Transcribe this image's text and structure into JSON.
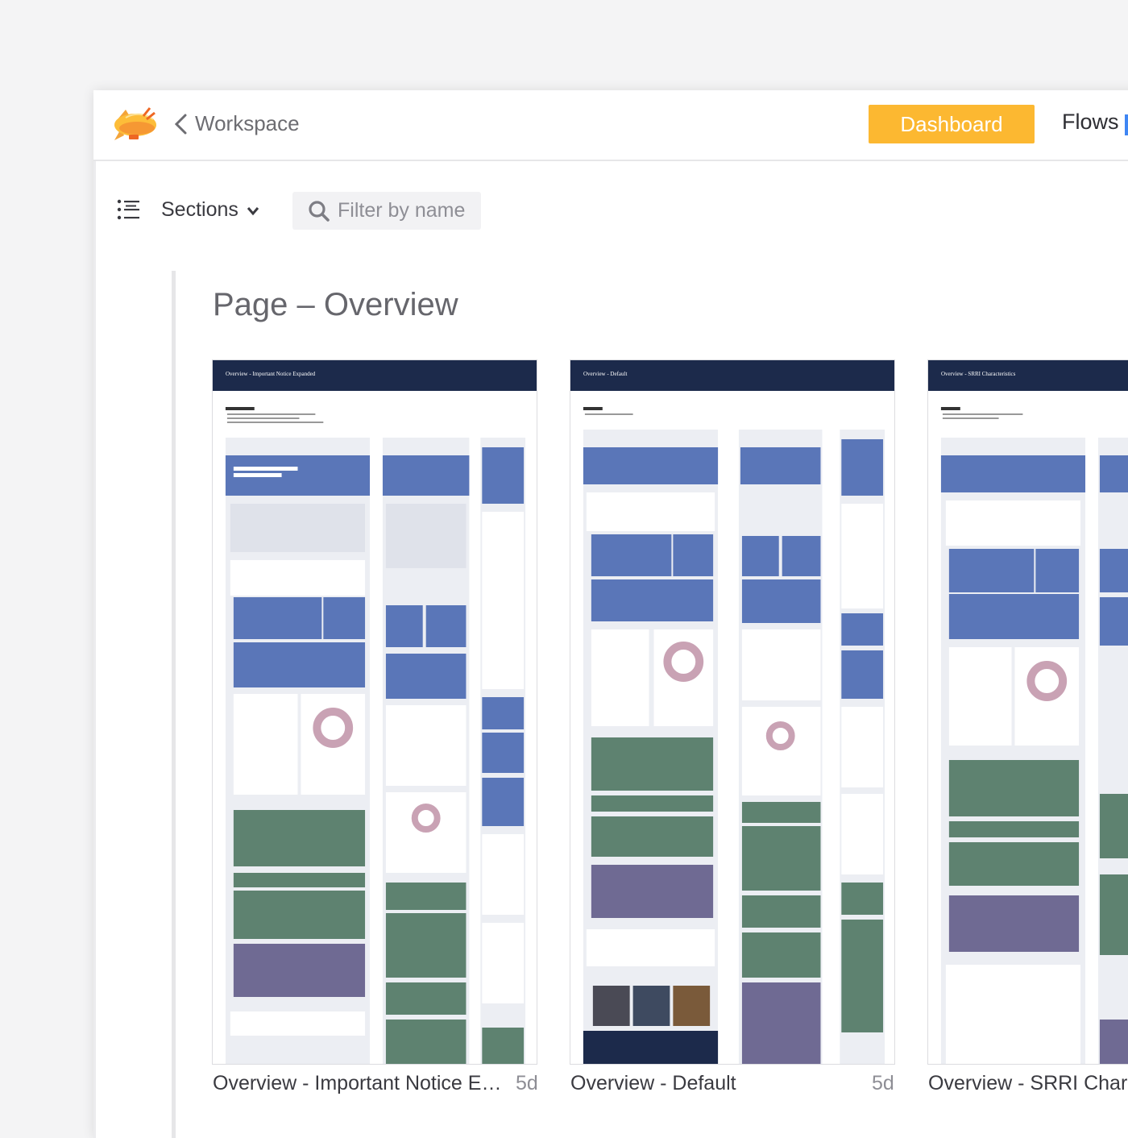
{
  "header": {
    "logo": "zeplin-blimp-logo",
    "back_icon": "chevron-left-icon",
    "workspace_label": "Workspace",
    "dashboard_label": "Dashboard",
    "flows_label": "Flows",
    "accent": "#fcb831",
    "flows_badge_color": "#3f86f3"
  },
  "toolbar": {
    "sections_icon": "list-icon",
    "sections_label": "Sections",
    "chevron_icon": "chevron-down-icon",
    "filter_icon": "search-icon",
    "filter_placeholder": "Filter by name"
  },
  "page": {
    "title": "Page – Overview"
  },
  "screens": [
    {
      "header_title": "Overview - Important Notice Expanded",
      "caption": "Overview - Important Notice Expanded",
      "age": "5d"
    },
    {
      "header_title": "Overview - Default",
      "caption": "Overview - Default",
      "age": "5d"
    },
    {
      "header_title": "Overview - SRRI Characteristics",
      "caption": "Overview - SRRI Characteristics",
      "age": ""
    }
  ],
  "colors": {
    "thumb_header": "#1c2a4b",
    "thumb_blue": "#5a76b8",
    "thumb_green": "#5e8270",
    "thumb_purple": "#6f6a93"
  }
}
